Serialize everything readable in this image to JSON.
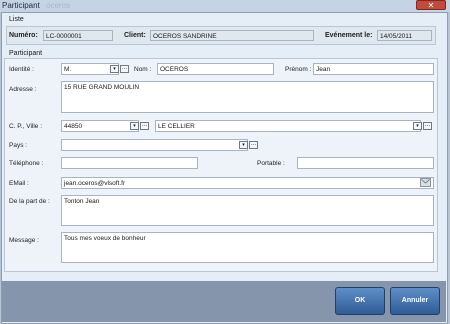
{
  "window": {
    "title": "Participant",
    "ghost_title": "oceros",
    "close_label": "✕"
  },
  "liste": {
    "section_label": "Liste",
    "numero_label": "Numéro:",
    "numero_value": "LC-0000001",
    "client_label": "Client:",
    "client_value": "OCEROS SANDRINE",
    "evenement_label": "Evénement le:",
    "evenement_value": "14/05/2011"
  },
  "participant": {
    "section_label": "Participant",
    "identite_label": "Identité :",
    "civilite_value": "M.",
    "nom_label": "Nom :",
    "nom_value": "OCEROS",
    "prenom_label": "Prénom :",
    "prenom_value": "Jean",
    "adresse_label": "Adresse :",
    "adresse_value": "15 RUE GRAND MOULIN",
    "cp_ville_label": "C. P., Ville :",
    "cp_value": "44850",
    "ville_value": "LE CELLIER",
    "pays_label": "Pays :",
    "pays_value": "",
    "telephone_label": "Téléphone :",
    "telephone_value": "",
    "portable_label": "Portable :",
    "portable_value": "",
    "email_label": "EMail :",
    "email_value": "jean.oceros@vlsoft.fr",
    "delapart_label": "De la part de :",
    "delapart_value": "Tonton Jean",
    "message_label": "Message :",
    "message_value": "Tous mes voeux de bonheur"
  },
  "buttons": {
    "ok": "OK",
    "annuler": "Annuler"
  },
  "icons": {
    "dropdown": "▾",
    "more": "..."
  }
}
